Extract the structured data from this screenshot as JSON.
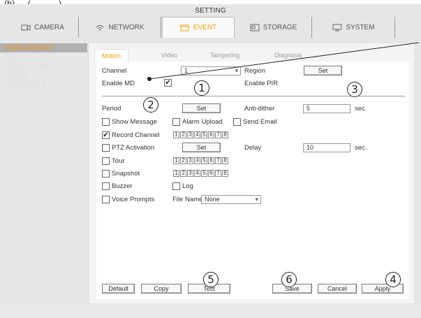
{
  "caption": "(b) ... (... ... ...) ... ... ... ...",
  "window": {
    "title": "SETTING"
  },
  "tabs": [
    {
      "label": "CAMERA",
      "icon": "camera-icon"
    },
    {
      "label": "NETWORK",
      "icon": "network-icon"
    },
    {
      "label": "EVENT",
      "icon": "event-icon",
      "active": true
    },
    {
      "label": "STORAGE",
      "icon": "storage-icon"
    },
    {
      "label": "SYSTEM",
      "icon": "system-icon"
    }
  ],
  "sidebar": {
    "items": [
      {
        "label": "VIDEO DETECT",
        "active": true
      },
      {
        "label": "IVS"
      },
      {
        "label": "FACE DETECT"
      },
      {
        "label": "ALARM"
      },
      {
        "label": "ABNORMALITY"
      }
    ]
  },
  "subtabs": [
    "Motion Detect",
    "Video Loss",
    "Tampering",
    "Diagnosis"
  ],
  "form": {
    "channel_label": "Channel",
    "channel_value": "1",
    "region_label": "Region",
    "set_label": "Set",
    "enable_md_label": "Enable MD",
    "enable_pir_label": "Enable PIR",
    "period_label": "Period",
    "anti_dither_label": "Anti-dither",
    "anti_dither_value": "5",
    "sec_label": "sec.",
    "show_message_label": "Show Message",
    "alarm_upload_label": "Alarm Upload",
    "send_email_label": "Send Email",
    "record_channel_label": "Record Channel",
    "ptz_activation_label": "PTZ Activation",
    "delay_label": "Delay",
    "delay_value": "10",
    "tour_label": "Tour",
    "snapshot_label": "Snapshot",
    "buzzer_label": "Buzzer",
    "log_label": "Log",
    "voice_prompts_label": "Voice Prompts",
    "file_name_label": "File Name",
    "file_name_value": "None",
    "channels": [
      "1",
      "2",
      "3",
      "4",
      "5",
      "6",
      "7",
      "8"
    ],
    "check_mark": "✔"
  },
  "buttons": {
    "default": "Default",
    "copy": "Copy",
    "test": "Test",
    "save": "Save",
    "cancel": "Cancel",
    "apply": "Apply"
  },
  "callouts": [
    "1",
    "2",
    "3",
    "4",
    "5",
    "6"
  ],
  "colors": {
    "accent": "#f0a000",
    "active_side": "#ff8a00"
  }
}
